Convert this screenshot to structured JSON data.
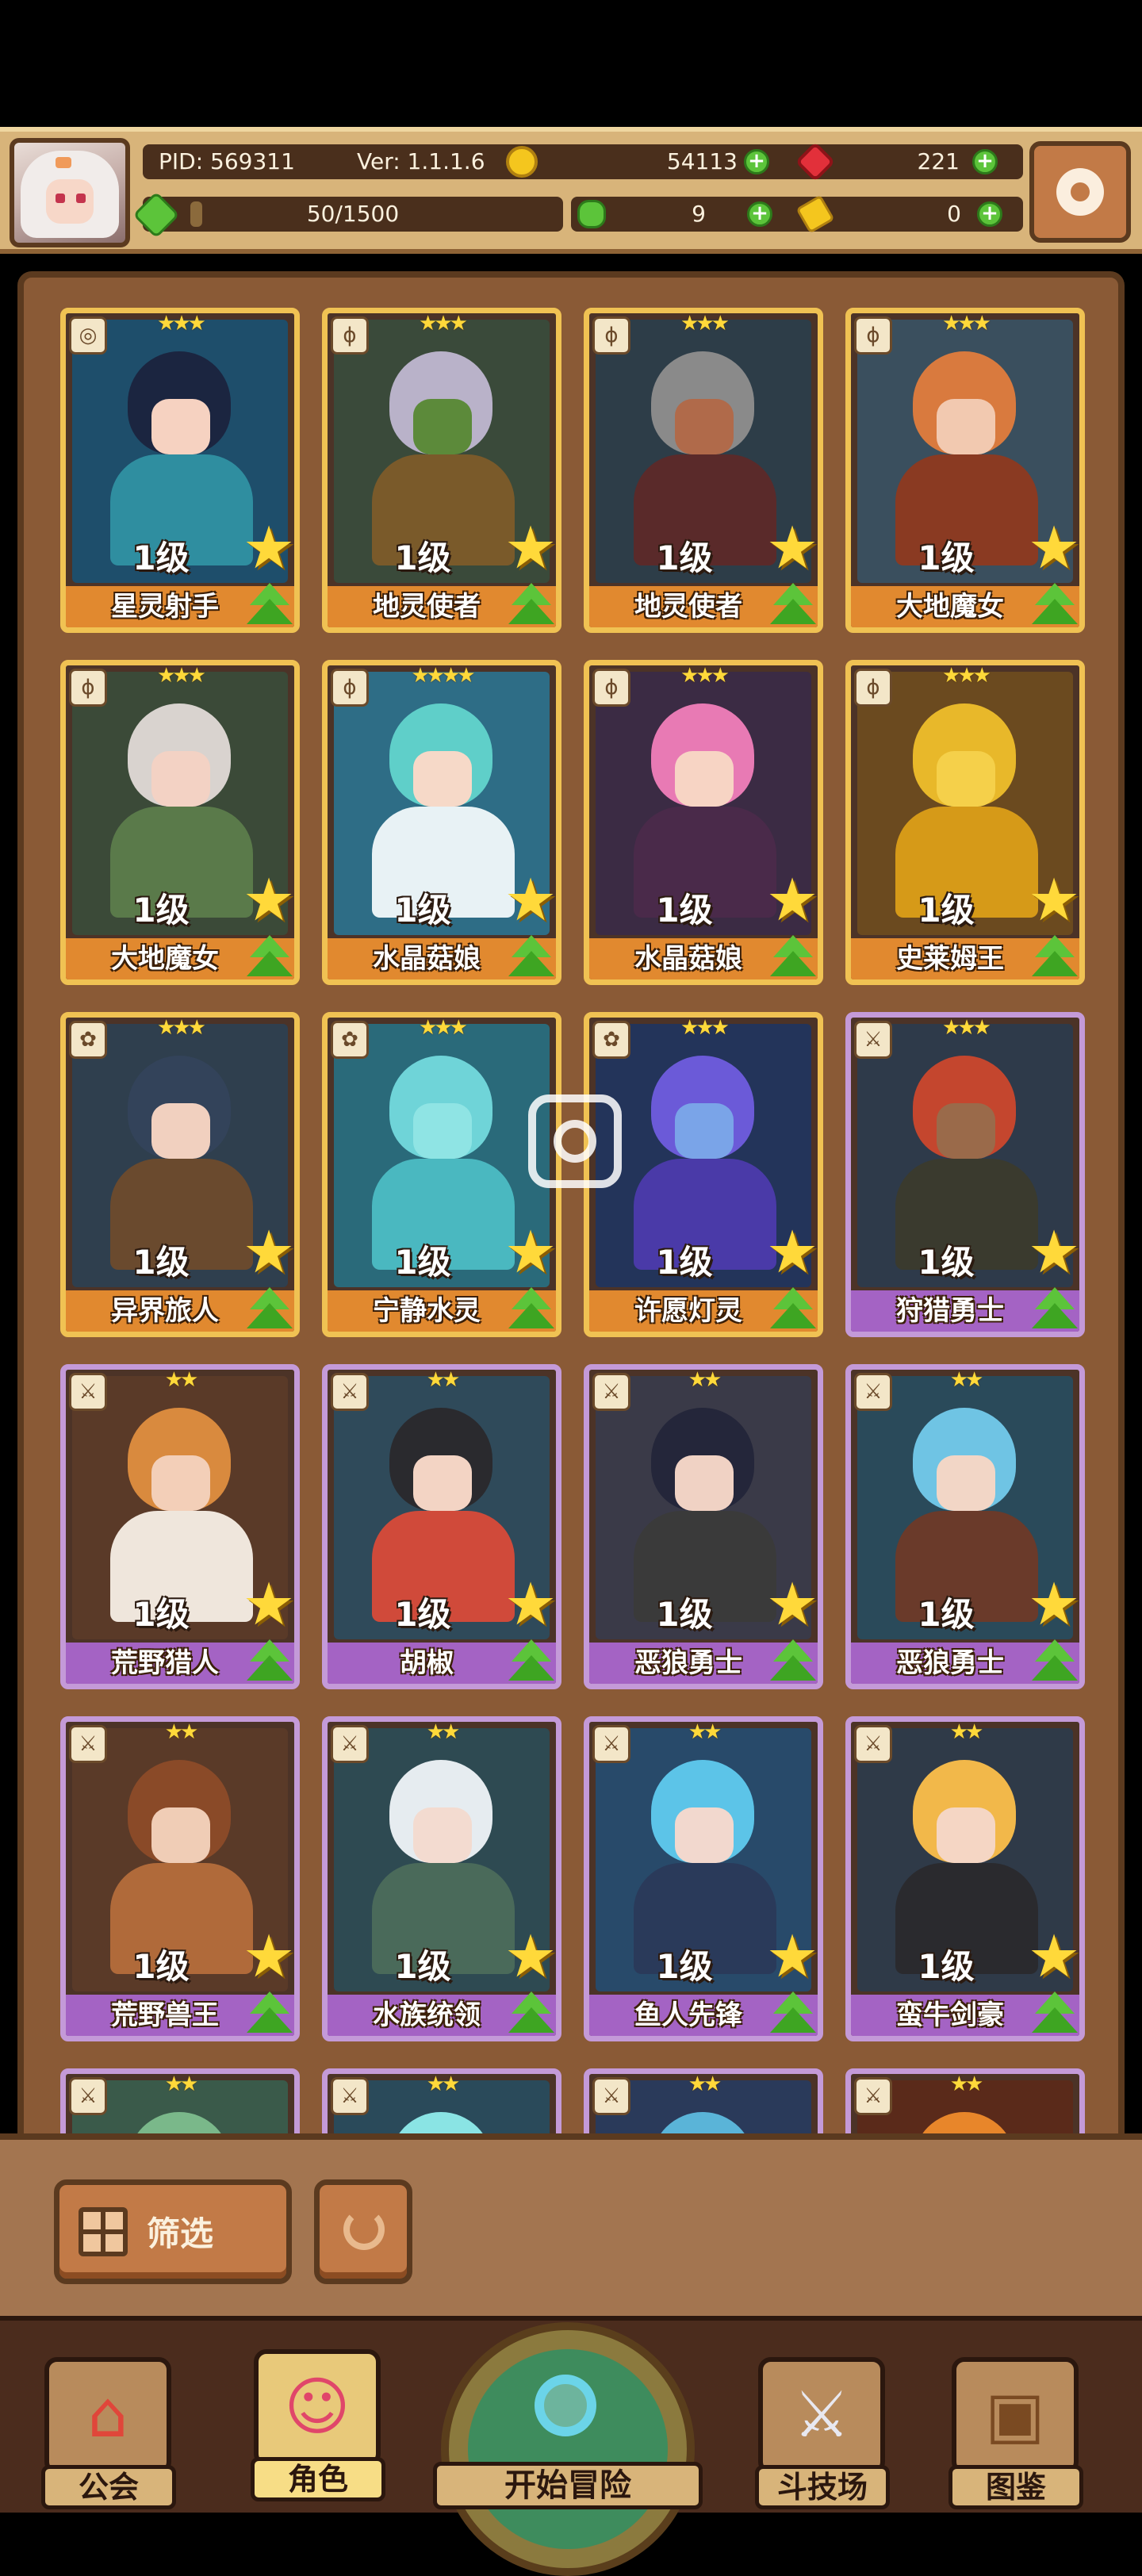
{
  "header": {
    "pid": "PID: 569311",
    "version": "Ver: 1.1.1.6",
    "gold": "54113",
    "gems": "221",
    "exp": "50/1500",
    "exp_fraction": 0.033,
    "clover": "9",
    "keys": "0",
    "icons": {
      "gold": "gold-coin-icon",
      "gem": "red-gem-icon",
      "exp": "green-diamond-icon",
      "clover": "clover-icon",
      "key": "key-icon",
      "settings": "gear-icon"
    }
  },
  "cards": [
    {
      "name": "星灵射手",
      "level": "1级",
      "stars": "★★★",
      "rarity": "gold",
      "class_icon": "bow-icon",
      "art": [
        "#1e4e6b",
        "#1b2540",
        "#f6d2c1",
        "#2f8ea0"
      ]
    },
    {
      "name": "地灵使者",
      "level": "1级",
      "stars": "★★★",
      "rarity": "gold",
      "class_icon": "staff-icon",
      "art": [
        "#3a4a3a",
        "#b9b2c9",
        "#5c8a3a",
        "#7a5a2a"
      ]
    },
    {
      "name": "地灵使者",
      "level": "1级",
      "stars": "★★★",
      "rarity": "gold",
      "class_icon": "staff-icon",
      "art": [
        "#2d3d48",
        "#8a8a8a",
        "#b06a4a",
        "#5a2a2a"
      ]
    },
    {
      "name": "大地魔女",
      "level": "1级",
      "stars": "★★★",
      "rarity": "gold",
      "class_icon": "staff-icon",
      "art": [
        "#3a4f5e",
        "#d97a3e",
        "#f2c9b0",
        "#8a3a22"
      ]
    },
    {
      "name": "大地魔女",
      "level": "1级",
      "stars": "★★★",
      "rarity": "gold",
      "class_icon": "staff-icon",
      "art": [
        "#3b4a38",
        "#d9d3cf",
        "#f3d2c4",
        "#5a7a4a"
      ]
    },
    {
      "name": "水晶菇娘",
      "level": "1级",
      "stars": "★★★★",
      "rarity": "gold",
      "class_icon": "staff-icon",
      "art": [
        "#2e6d86",
        "#5fcfc9",
        "#f6d9c8",
        "#e8f2f5"
      ]
    },
    {
      "name": "水晶菇娘",
      "level": "1级",
      "stars": "★★★",
      "rarity": "gold",
      "class_icon": "staff-icon",
      "art": [
        "#3b2b44",
        "#e87ab4",
        "#f7d4c4",
        "#4a2a4a"
      ]
    },
    {
      "name": "史莱姆王",
      "level": "1级",
      "stars": "★★★",
      "rarity": "gold",
      "class_icon": "staff-icon",
      "art": [
        "#6b4a1f",
        "#e8b82a",
        "#f5d04a",
        "#d69a18"
      ]
    },
    {
      "name": "异界旅人",
      "level": "1级",
      "stars": "★★★",
      "rarity": "gold",
      "class_icon": "shield-icon",
      "art": [
        "#2f3f4e",
        "#33435a",
        "#f1d0bf",
        "#6a4a2e"
      ]
    },
    {
      "name": "宁静水灵",
      "level": "1级",
      "stars": "★★★",
      "rarity": "gold",
      "class_icon": "shield-icon",
      "art": [
        "#2a6a7a",
        "#6fd4d8",
        "#8fe4e4",
        "#4ab8c0"
      ]
    },
    {
      "name": "许愿灯灵",
      "level": "1级",
      "stars": "★★★",
      "rarity": "gold",
      "class_icon": "shield-icon",
      "art": [
        "#23345a",
        "#6b5ad8",
        "#7aa4e8",
        "#4a3aa8"
      ]
    },
    {
      "name": "狩猎勇士",
      "level": "1级",
      "stars": "★★★",
      "rarity": "purple",
      "class_icon": "sword-icon",
      "art": [
        "#2e3a4a",
        "#c4462e",
        "#9a6a4a",
        "#3a3a2e"
      ]
    },
    {
      "name": "荒野猎人",
      "level": "1级",
      "stars": "★★",
      "rarity": "purple",
      "class_icon": "sword-icon",
      "art": [
        "#5a3a28",
        "#d98a3e",
        "#f3cfb8",
        "#efe6dc"
      ]
    },
    {
      "name": "胡椒",
      "level": "1级",
      "stars": "★★",
      "rarity": "purple",
      "class_icon": "sword-icon",
      "art": [
        "#2f4a5a",
        "#2a2a2e",
        "#f3d4c4",
        "#d04a3a"
      ]
    },
    {
      "name": "恶狼勇士",
      "level": "1级",
      "stars": "★★",
      "rarity": "purple",
      "class_icon": "sword-icon",
      "art": [
        "#3a3a48",
        "#24263a",
        "#f0d2c4",
        "#3a3a3a"
      ]
    },
    {
      "name": "恶狼勇士",
      "level": "1级",
      "stars": "★★",
      "rarity": "purple",
      "class_icon": "sword-icon",
      "art": [
        "#2a4a5a",
        "#6fc4e4",
        "#f2d6c6",
        "#6a3a2a"
      ]
    },
    {
      "name": "荒野兽王",
      "level": "1级",
      "stars": "★★",
      "rarity": "purple",
      "class_icon": "sword-icon",
      "art": [
        "#5a3a28",
        "#8a4a28",
        "#f0cdb6",
        "#b06a3a"
      ]
    },
    {
      "name": "水族统领",
      "level": "1级",
      "stars": "★★",
      "rarity": "purple",
      "class_icon": "sword-icon",
      "art": [
        "#2e4a52",
        "#e6ecf0",
        "#f3dbd0",
        "#4a6a5a"
      ]
    },
    {
      "name": "鱼人先锋",
      "level": "1级",
      "stars": "★★",
      "rarity": "purple",
      "class_icon": "sword-icon",
      "art": [
        "#284a6a",
        "#5cc4e8",
        "#f2d8ce",
        "#2a3a5a"
      ]
    },
    {
      "name": "蛮牛剑豪",
      "level": "1级",
      "stars": "★★",
      "rarity": "purple",
      "class_icon": "sword-icon",
      "art": [
        "#2f3a48",
        "#f2b84a",
        "#f5d6c4",
        "#2a2a2e"
      ]
    },
    {
      "name": "",
      "level": "",
      "stars": "★★",
      "rarity": "purple",
      "class_icon": "sword-icon",
      "art": [
        "#3a5a4a",
        "#7ab88a",
        "#7ab88a",
        "#3a5a4a"
      ]
    },
    {
      "name": "",
      "level": "",
      "stars": "★★",
      "rarity": "purple",
      "class_icon": "sword-icon",
      "art": [
        "#2a4a5a",
        "#8ae4e4",
        "#8ae4e4",
        "#2a4a5a"
      ]
    },
    {
      "name": "",
      "level": "",
      "stars": "★★",
      "rarity": "purple",
      "class_icon": "sword-icon",
      "art": [
        "#2a3a5a",
        "#5ab4d8",
        "#5ab4d8",
        "#2a3a5a"
      ]
    },
    {
      "name": "",
      "level": "",
      "stars": "★★",
      "rarity": "purple",
      "class_icon": "sword-icon",
      "art": [
        "#5a2a1a",
        "#e8862a",
        "#e8862a",
        "#5a2a1a"
      ]
    }
  ],
  "filter": {
    "label": "筛选",
    "icons": {
      "filter": "grid-filter-icon",
      "reset": "refresh-icon"
    }
  },
  "nav": {
    "guild": "公会",
    "hero": "角色",
    "adventure": "开始冒险",
    "arena": "斗技场",
    "codex": "图鉴",
    "active": "hero",
    "icons": {
      "guild": "guild-house-icon",
      "hero": "hero-face-icon",
      "adventure": "magnifier-map-icon",
      "arena": "crossed-swords-icon",
      "codex": "book-icon"
    }
  }
}
